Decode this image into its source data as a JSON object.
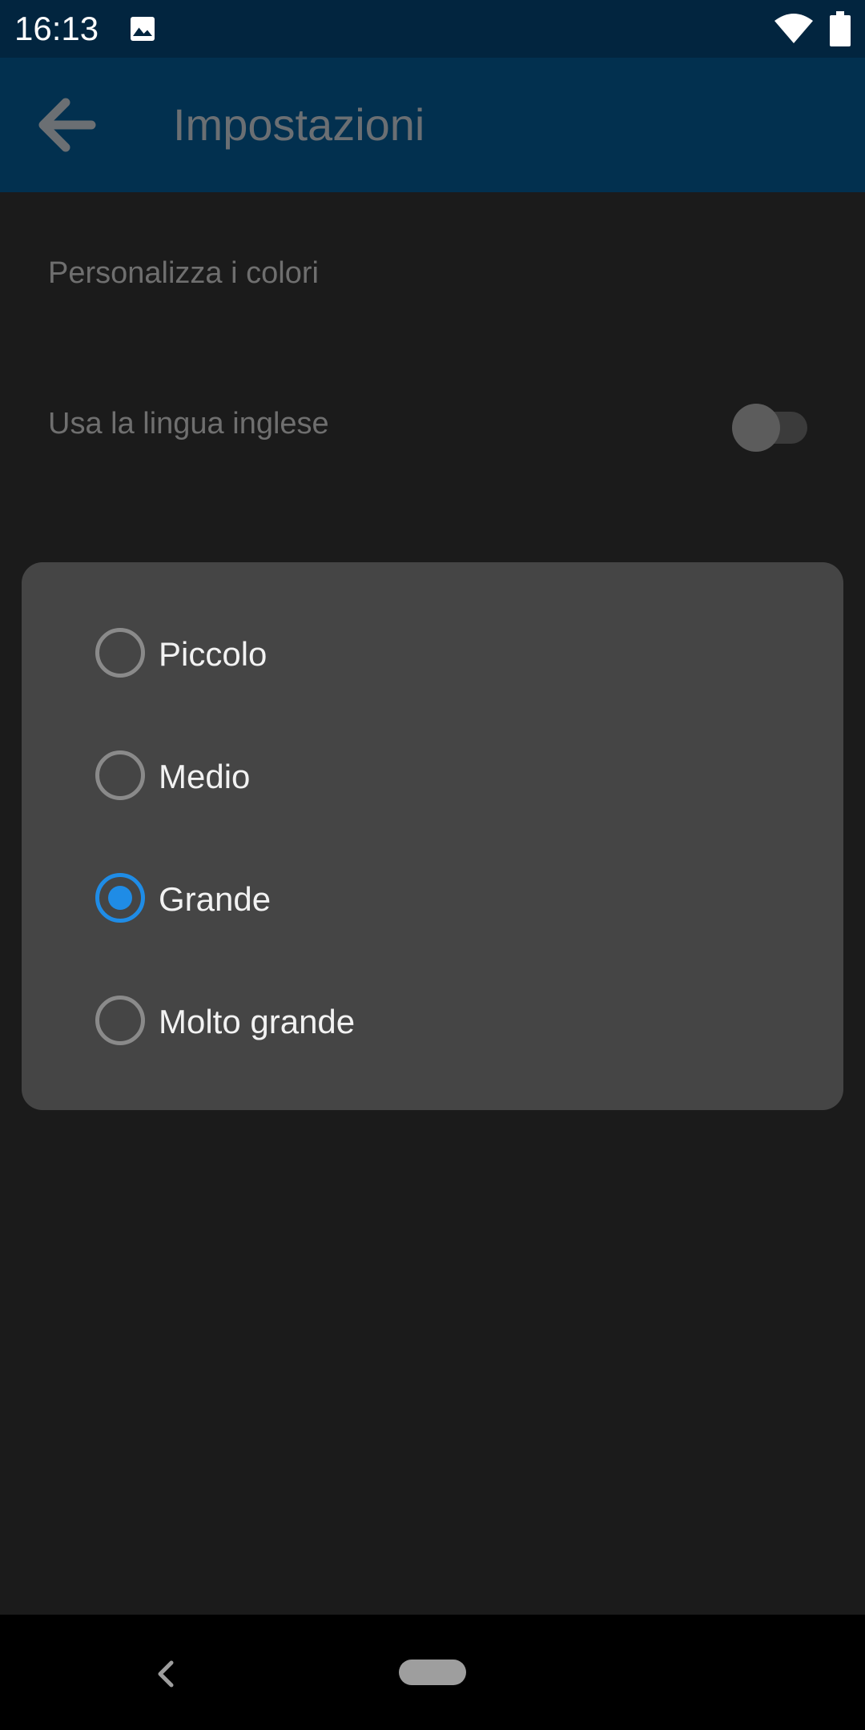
{
  "status_bar": {
    "time": "16:13",
    "icons": [
      "image-icon",
      "wifi-icon",
      "battery-icon"
    ]
  },
  "app_bar": {
    "title": "Impostazioni",
    "back_icon": "arrow-left-icon"
  },
  "settings": {
    "items": [
      {
        "label": "Personalizza i colori"
      },
      {
        "label": "Usa la lingua inglese",
        "toggle": false
      }
    ]
  },
  "dialog": {
    "options": [
      {
        "label": "Piccolo",
        "selected": false
      },
      {
        "label": "Medio",
        "selected": false
      },
      {
        "label": "Grande",
        "selected": true
      },
      {
        "label": "Molto grande",
        "selected": false
      }
    ]
  },
  "colors": {
    "status_bar": "#02253f",
    "app_bar": "#02304f",
    "background": "#1b1b1b",
    "dialog": "#454545",
    "accent": "#1f8ce6"
  }
}
